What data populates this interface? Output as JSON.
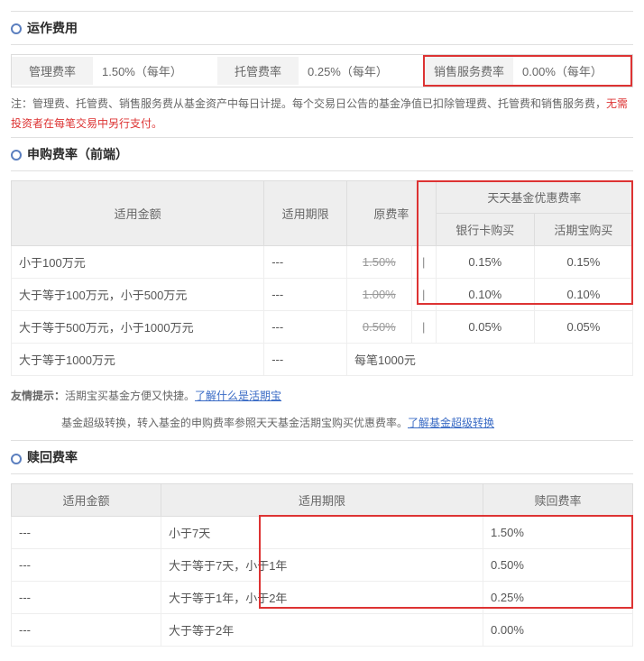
{
  "sections": {
    "operating": "运作费用",
    "purchase": "申购费率（前端）",
    "redeem": "赎回费率"
  },
  "operating": {
    "mgmt_label": "管理费率",
    "mgmt_val": "1.50%（每年）",
    "cust_label": "托管费率",
    "cust_val": "0.25%（每年）",
    "svc_label": "销售服务费率",
    "svc_val": "0.00%（每年）",
    "note_a": "注：管理费、托管费、销售服务费从基金资产中每日计提。每个交易日公告的基金净值已扣除管理费、托管费和销售服务费，",
    "note_b": "无需投资者在每笔交易中另行支付。"
  },
  "purchase": {
    "th_amount": "适用金额",
    "th_period": "适用期限",
    "th_orig": "原费率",
    "th_tt": "天天基金优惠费率",
    "th_bank": "银行卡购买",
    "th_hqb": "活期宝购买",
    "rows": [
      {
        "amount": "小于100万元",
        "period": "---",
        "orig": "1.50%",
        "sep": "|",
        "bank": "0.15%",
        "hqb": "0.15%"
      },
      {
        "amount": "大于等于100万元，小于500万元",
        "period": "---",
        "orig": "1.00%",
        "sep": "|",
        "bank": "0.10%",
        "hqb": "0.10%"
      },
      {
        "amount": "大于等于500万元，小于1000万元",
        "period": "---",
        "orig": "0.50%",
        "sep": "|",
        "bank": "0.05%",
        "hqb": "0.05%"
      },
      {
        "amount": "大于等于1000万元",
        "period": "---",
        "orig": "",
        "sep": "",
        "bank": "每笔1000元",
        "hqb": ""
      }
    ],
    "tip1a": "友情提示：",
    "tip1b": "活期宝买基金方便又快捷。",
    "link1": "了解什么是活期宝",
    "tip2a": "基金超级转换，转入基金的申购费率参照天天基金活期宝购买优惠费率。",
    "link2": "了解基金超级转换"
  },
  "redeem": {
    "th_amount": "适用金额",
    "th_period": "适用期限",
    "th_rate": "赎回费率",
    "rows": [
      {
        "amount": "---",
        "period": "小于7天",
        "rate": "1.50%"
      },
      {
        "amount": "---",
        "period": "大于等于7天，小于1年",
        "rate": "0.50%"
      },
      {
        "amount": "---",
        "period": "大于等于1年，小于2年",
        "rate": "0.25%"
      },
      {
        "amount": "---",
        "period": "大于等于2年",
        "rate": "0.00%"
      }
    ]
  }
}
